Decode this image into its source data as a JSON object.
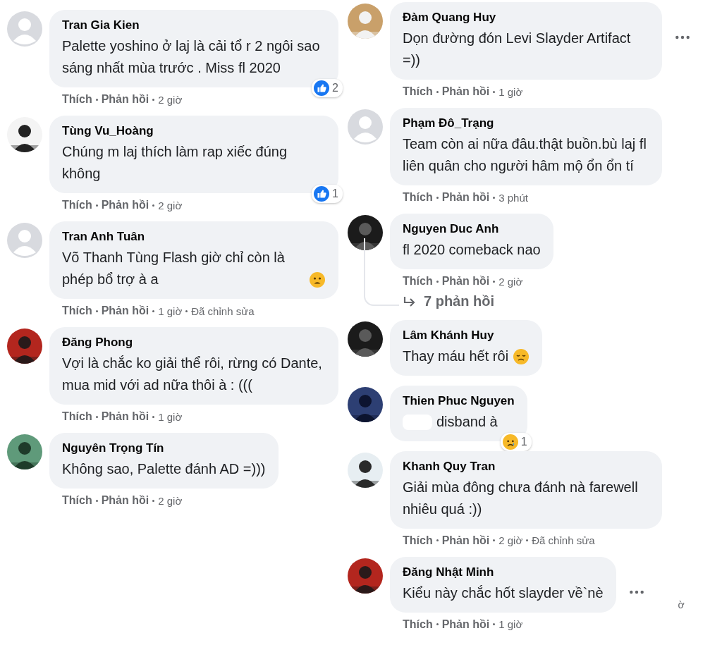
{
  "columns": [
    {
      "comments": [
        {
          "avatar": {
            "kind": "default"
          },
          "name": "Tran Gia Kien",
          "text": "Palette yoshino ở laj là cải tổ r 2 ngôi sao sáng nhất mùa trước . Miss fl 2020",
          "reaction": {
            "kind": "like",
            "count": "2"
          },
          "actions": [
            "Thích",
            "Phản hồi"
          ],
          "time": "2 giờ"
        },
        {
          "name": "Tùng Vu_Hoàng",
          "text": "Chúng m laj thích làm rap xiếc đúng không",
          "reaction": {
            "kind": "like",
            "count": "1"
          },
          "actions": [
            "Thích",
            "Phản hồi"
          ],
          "time": "2 giờ"
        },
        {
          "avatar": {
            "kind": "default"
          },
          "name": "Tran Anh Tuân",
          "text": "Võ Thanh Tùng Flash giờ chỉ còn là phép bổ trợ à a",
          "emoji": {
            "kind": "frown"
          },
          "actions": [
            "Thích",
            "Phản hồi"
          ],
          "time": "1 giờ",
          "edited": "Đã chỉnh sửa"
        },
        {
          "name": "Đăng Phong",
          "text": "Vợi là chắc ko giải thể rôi, rừng có Dante, mua mid với ad nữa thôi à : (((",
          "actions": [
            "Thích",
            "Phản hồi"
          ],
          "time": "1 giờ"
        },
        {
          "name": "Nguyên Trọng Tín",
          "text": "Không sao, Palette đánh AD =)))",
          "actions": [
            "Thích",
            "Phản hồi"
          ],
          "time": "2 giờ"
        }
      ]
    },
    {
      "comments": [
        {
          "name": "Đàm Quang Huy",
          "text": "Dọn đường đón Levi Slayder Artifact =))",
          "more_shown": true,
          "actions": [
            "Thích",
            "Phản hồi"
          ],
          "time": "1 giờ"
        },
        {
          "avatar": {
            "kind": "default"
          },
          "name": "Phạm Đô_Trạng",
          "text": "Team còn ai nữa đâu.thật buồn.bù laj fl liên quân cho người hâm mộ ổn ổn tí",
          "actions": [
            "Thích",
            "Phản hồi"
          ],
          "time": "3 phút"
        },
        {
          "name": "Nguyen Duc Anh",
          "text": "fl 2020 comeback nao",
          "actions": [
            "Thích",
            "Phản hồi"
          ],
          "time": "2 giờ",
          "replies": "7 phản hồi"
        },
        {
          "name": "Lâm Khánh Huy",
          "text": "Thay máu hết rôi",
          "emoji": {
            "kind": "sad"
          }
        },
        {
          "name": "Thien Phuc Nguyen",
          "text": "disband à",
          "redacted": true,
          "reaction": {
            "kind": "cry",
            "count": "1"
          }
        },
        {
          "name": "Khanh Quy Tran",
          "text": "Giải mùa đông chưa đánh nà farewell nhiêu quá :))",
          "actions": [
            "Thích",
            "Phản hồi"
          ],
          "time": "2 giờ",
          "edited": "Đã chỉnh sửa"
        },
        {
          "name": "Đăng Nhật Minh",
          "text": "Kiểu này chắc hốt slayder về`nè",
          "more_shown": true,
          "fragment": "ờ",
          "actions": [
            "Thích",
            "Phản hồi"
          ],
          "time": "1 giờ"
        }
      ]
    }
  ]
}
